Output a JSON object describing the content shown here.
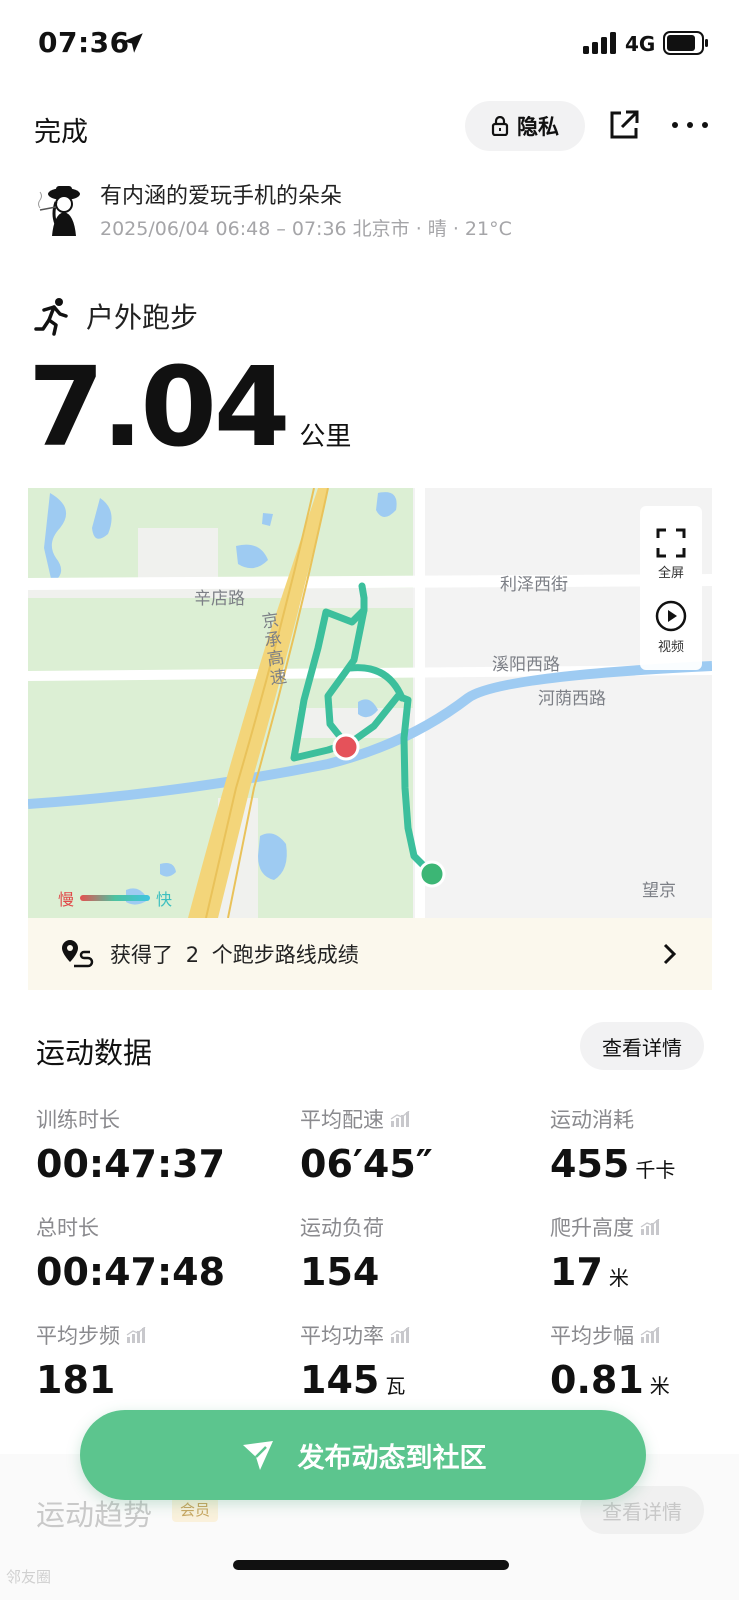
{
  "status_bar": {
    "time": "07:36",
    "network": "4G"
  },
  "header": {
    "done_label": "完成",
    "privacy_label": "隐私"
  },
  "user": {
    "name": "有内涵的爱玩手机的朵朵",
    "meta": "2025/06/04 06:48 – 07:36 北京市 · 晴 · 21°C"
  },
  "activity": {
    "type": "户外跑步",
    "distance": "7.04",
    "distance_unit": "公里"
  },
  "map": {
    "fullscreen_label": "全屏",
    "video_label": "视频",
    "legend_slow": "慢",
    "legend_fast": "快",
    "labels": {
      "xindian": "辛店路",
      "lize": "利泽西街",
      "jingcheng": "京承高速",
      "xiyang": "溪阳西路",
      "heyin": "河荫西路",
      "wangjing": "望京"
    },
    "colors": {
      "route": "#3cbf9c",
      "start": "#e5525a",
      "end": "#3cb675",
      "river": "#9ecbf2",
      "highway": "#f3d57a"
    }
  },
  "achievement": {
    "prefix": "获得了",
    "count": "2",
    "suffix": "个跑步路线成绩"
  },
  "exercise_data": {
    "title": "运动数据",
    "detail_label": "查看详情",
    "stats": [
      {
        "label": "训练时长",
        "value": "00:47:37",
        "unit": ""
      },
      {
        "label": "平均配速",
        "value": "06′45″",
        "unit": ""
      },
      {
        "label": "运动消耗",
        "value": "455",
        "unit": "千卡"
      },
      {
        "label": "总时长",
        "value": "00:47:48",
        "unit": ""
      },
      {
        "label": "运动负荷",
        "value": "154",
        "unit": ""
      },
      {
        "label": "爬升高度",
        "value": "17",
        "unit": "米"
      },
      {
        "label": "平均步频",
        "value": "181",
        "unit": ""
      },
      {
        "label": "平均功率",
        "value": "145",
        "unit": "瓦"
      },
      {
        "label": "平均步幅",
        "value": "0.81",
        "unit": "米"
      }
    ]
  },
  "publish_label": "发布动态到社区",
  "trend": {
    "title": "运动趋势",
    "badge": "会员",
    "detail_label": "查看详情"
  },
  "watermark": "邻友圈"
}
